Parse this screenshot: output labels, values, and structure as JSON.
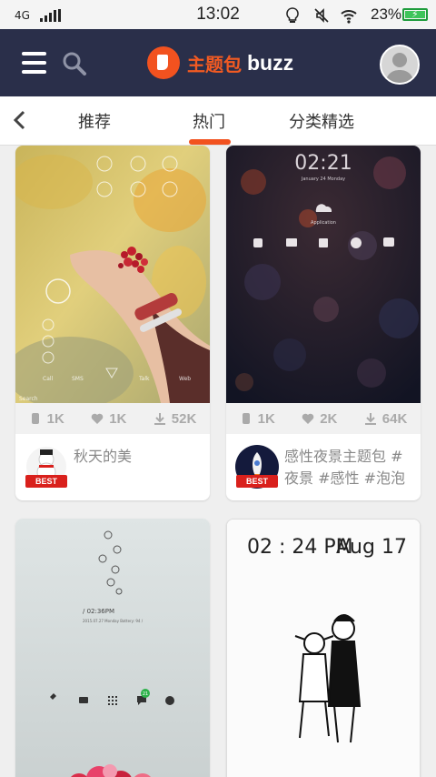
{
  "status_bar": {
    "network": "4G",
    "time": "13:02",
    "battery_percent": "23%",
    "icons": [
      "signal-icon",
      "bulb-icon",
      "mute-icon",
      "wifi-icon",
      "battery-icon"
    ]
  },
  "app_bar": {
    "brand_name": "主题包",
    "brand_suffix": "buzz",
    "colors": {
      "bar": "#2a2f4a",
      "accent": "#f2521f"
    }
  },
  "tabs": {
    "items": [
      {
        "label": "推荐"
      },
      {
        "label": "热门",
        "active": true
      },
      {
        "label": "分类精选"
      }
    ]
  },
  "cards": [
    {
      "downloads_icon_count": "1K",
      "likes": "1K",
      "installs": "52K",
      "badge": "BEST",
      "description": "秋天的美",
      "preview": {
        "search_text": "Search",
        "dock": [
          "Call",
          "SMS",
          "Talk",
          "Web"
        ]
      }
    },
    {
      "downloads_icon_count": "1K",
      "likes": "2K",
      "installs": "64K",
      "badge": "BEST",
      "description_line1": "感性夜景主题包 #",
      "description_line2": "夜景 #感性 #泡泡",
      "preview": {
        "clock": "02:21",
        "date": "January 24 Monday",
        "weather_label": "Application"
      }
    },
    {
      "preview": {
        "time": "/ 02:36PM",
        "date_line": "2015.07.27 Monday    Battery: 94 /",
        "notif_count": "21"
      }
    },
    {
      "preview": {
        "clock": "02 : 24 PM",
        "date": "Aug 17"
      }
    }
  ]
}
